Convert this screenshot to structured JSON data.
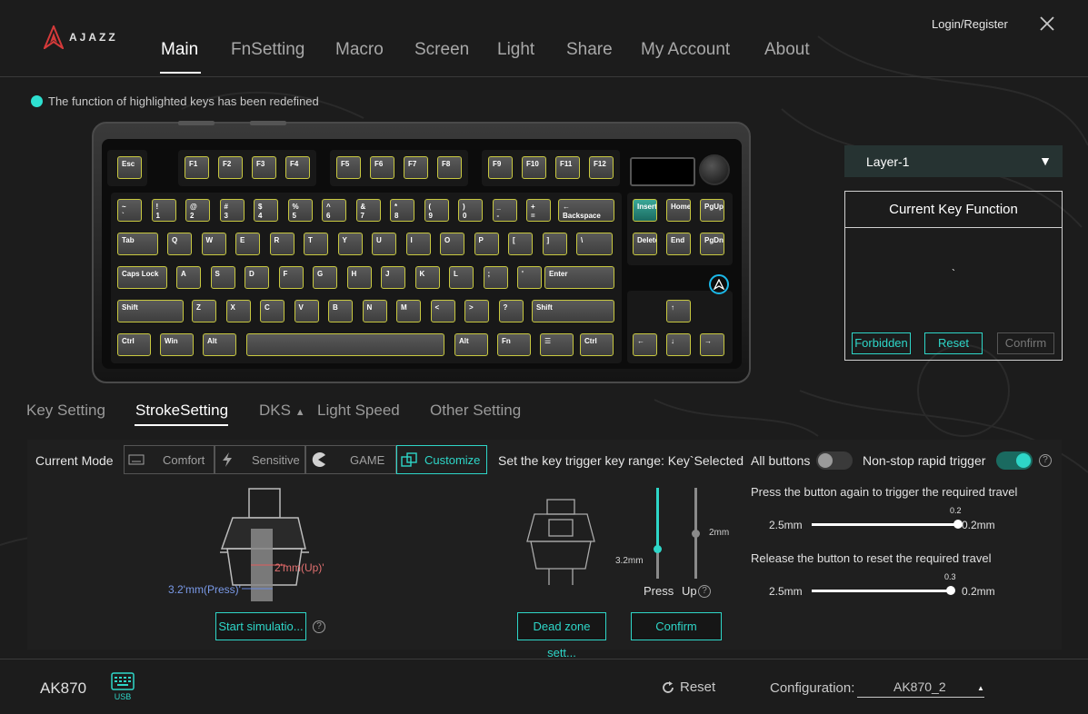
{
  "header": {
    "brand": "AJAZZ",
    "tabs": [
      "Main",
      "FnSetting",
      "Macro",
      "Screen",
      "Light",
      "Share",
      "My Account",
      "About"
    ],
    "active_tab": "Main",
    "login": "Login/Register"
  },
  "notice": "The function of highlighted keys has been redefined",
  "keyboard": {
    "fn_row": [
      "Esc",
      "F1",
      "F2",
      "F3",
      "F4",
      "F5",
      "F6",
      "F7",
      "F8",
      "F9",
      "F10",
      "F11",
      "F12"
    ],
    "row1": [
      [
        "~",
        "`"
      ],
      [
        "!",
        "1"
      ],
      [
        "@",
        "2"
      ],
      [
        "#",
        "3"
      ],
      [
        "$",
        "4"
      ],
      [
        "%",
        "5"
      ],
      [
        "^",
        "6"
      ],
      [
        "&",
        "7"
      ],
      [
        "*",
        "8"
      ],
      [
        "(",
        "9"
      ],
      [
        ")",
        "0"
      ],
      [
        "_",
        "-"
      ],
      [
        "+",
        "="
      ],
      [
        "← Backspace",
        ""
      ]
    ],
    "row2": [
      "Tab",
      "Q",
      "W",
      "E",
      "R",
      "T",
      "Y",
      "U",
      "I",
      "O",
      "P",
      "[",
      "]",
      "\\"
    ],
    "row3": [
      "Caps Lock",
      "A",
      "S",
      "D",
      "F",
      "G",
      "H",
      "J",
      "K",
      "L",
      ";",
      "'",
      "Enter"
    ],
    "row4": [
      "Shift",
      "Z",
      "X",
      "C",
      "V",
      "B",
      "N",
      "M",
      "<",
      ">",
      "?",
      "Shift"
    ],
    "row5": [
      "Ctrl",
      "Win",
      "Alt",
      "",
      "Alt",
      "Fn",
      "☰",
      "Ctrl"
    ],
    "nav": [
      "Insert",
      "Home",
      "PgUp",
      "Delete",
      "End",
      "PgDn"
    ],
    "highlighted": "Insert"
  },
  "right_panel": {
    "layer": "Layer-1",
    "ckf_title": "Current Key Function",
    "ckf_value": "`",
    "buttons": [
      "Forbidden",
      "Reset",
      "Confirm"
    ]
  },
  "subtabs": [
    "Key Setting",
    "StrokeSetting",
    "DKS",
    "Light Speed",
    "Other Setting"
  ],
  "active_subtab": "StrokeSetting",
  "stroke": {
    "current_mode_label": "Current Mode",
    "modes": [
      "Comfort",
      "Sensitive",
      "GAME",
      "Customize"
    ],
    "active_mode": "Customize",
    "trigger_label": "Set the key trigger key range: Key`Selected",
    "all_buttons_label": "All buttons",
    "all_buttons_on": false,
    "nonstop_label": "Non-stop rapid trigger",
    "nonstop_on": true,
    "up_label": "2'mm(Up)'",
    "press_label": "3.2'mm(Press)'",
    "start_sim": "Start simulatio...",
    "dead_zone": "Dead zone sett...",
    "confirm": "Confirm",
    "press_value_label": "3.2mm",
    "up_value_label": "2mm",
    "press_caption": "Press",
    "up_caption": "Up",
    "press_travel_fraction": 0.67,
    "up_travel_fraction": 0.5,
    "press_again_label": "Press the button again to trigger the required travel",
    "press_again": {
      "min": "2.5mm",
      "max": "0.2mm",
      "value": "0.2"
    },
    "release_label": "Release the button to reset the required travel",
    "release": {
      "min": "2.5mm",
      "max": "0.2mm",
      "value": "0.3"
    }
  },
  "footer": {
    "device": "AK870",
    "usb": "USB",
    "reset": "Reset",
    "config_label": "Configuration:",
    "config_value": "AK870_2"
  },
  "colors": {
    "accent": "#2ed6c8",
    "key_border": "#c8c840"
  }
}
